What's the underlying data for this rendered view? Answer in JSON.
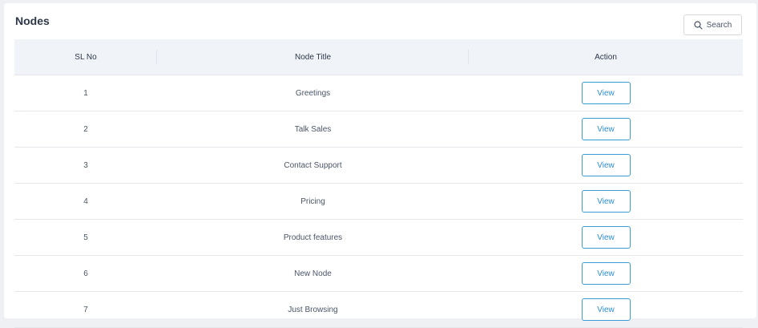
{
  "page": {
    "title": "Nodes"
  },
  "search": {
    "label": "Search",
    "icon": "search-icon"
  },
  "table": {
    "columns": [
      "SL No",
      "Node Title",
      "Action"
    ],
    "rows": [
      {
        "sl": "1",
        "title": "Greetings",
        "action": "View"
      },
      {
        "sl": "2",
        "title": "Talk Sales",
        "action": "View"
      },
      {
        "sl": "3",
        "title": "Contact Support",
        "action": "View"
      },
      {
        "sl": "4",
        "title": "Pricing",
        "action": "View"
      },
      {
        "sl": "5",
        "title": "Product features",
        "action": "View"
      },
      {
        "sl": "6",
        "title": "New Node",
        "action": "View"
      },
      {
        "sl": "7",
        "title": "Just Browsing",
        "action": "View"
      }
    ]
  },
  "colors": {
    "accent": "#2b8ccf",
    "header_bg": "#f0f3f8",
    "page_bg": "#eef0f3"
  }
}
